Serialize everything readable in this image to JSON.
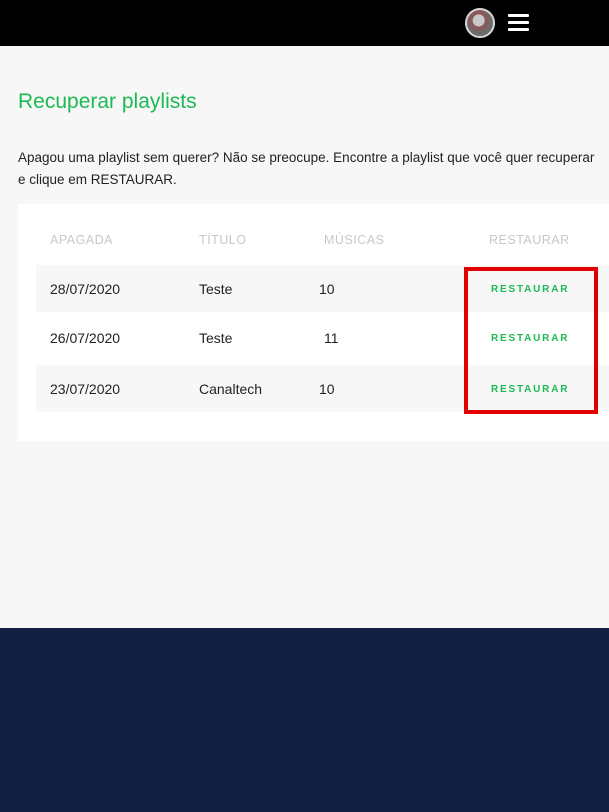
{
  "header": {
    "avatar_icon": "user-avatar",
    "menu_icon": "hamburger-menu-icon"
  },
  "page": {
    "title": "Recuperar playlists",
    "description": "Apagou uma playlist sem querer? Não se preocupe. Encontre a playlist que você quer recuperar e clique em RESTAURAR."
  },
  "table": {
    "headers": {
      "date": "APAGADA",
      "title": "TÍTULO",
      "songs": "MÚSICAS",
      "restore": "RESTAURAR"
    },
    "rows": [
      {
        "date": "28/07/2020",
        "title": "Teste",
        "songs": "10",
        "action": "RESTAURAR"
      },
      {
        "date": "26/07/2020",
        "title": "Teste",
        "songs": "11",
        "action": "RESTAURAR"
      },
      {
        "date": "23/07/2020",
        "title": "Canaltech",
        "songs": "10",
        "action": "RESTAURAR"
      }
    ]
  },
  "colors": {
    "accent": "#1db954",
    "highlight": "#e00000",
    "footer": "#131f40",
    "topbar": "#000000"
  }
}
